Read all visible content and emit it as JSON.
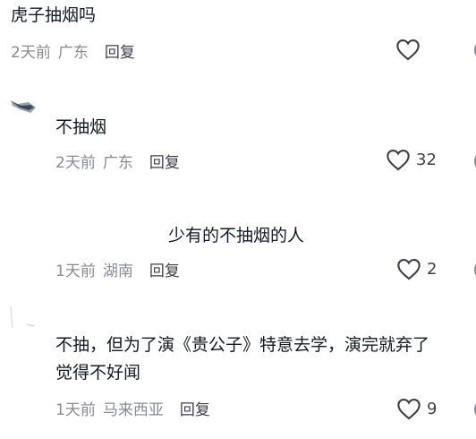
{
  "comments": [
    {
      "text": "虎子抽烟吗",
      "date": "2天前",
      "location": "广东",
      "reply_label": "回复",
      "likes": ""
    },
    {
      "text": "不抽烟",
      "date": "2天前",
      "location": "广东",
      "reply_label": "回复",
      "likes": "32"
    },
    {
      "text": "少有的不抽烟的人",
      "date": "1天前",
      "location": "湖南",
      "reply_label": "回复",
      "likes": "2"
    },
    {
      "text_line1": "不抽，但为了演《贵公子》特意去学，演完就弃了",
      "text_line2": "觉得不好闻",
      "date": "1天前",
      "location": "马来西亚",
      "reply_label": "回复",
      "likes": "9"
    }
  ],
  "icons": {
    "like": "heart-outline-icon",
    "more": "more-icon"
  }
}
